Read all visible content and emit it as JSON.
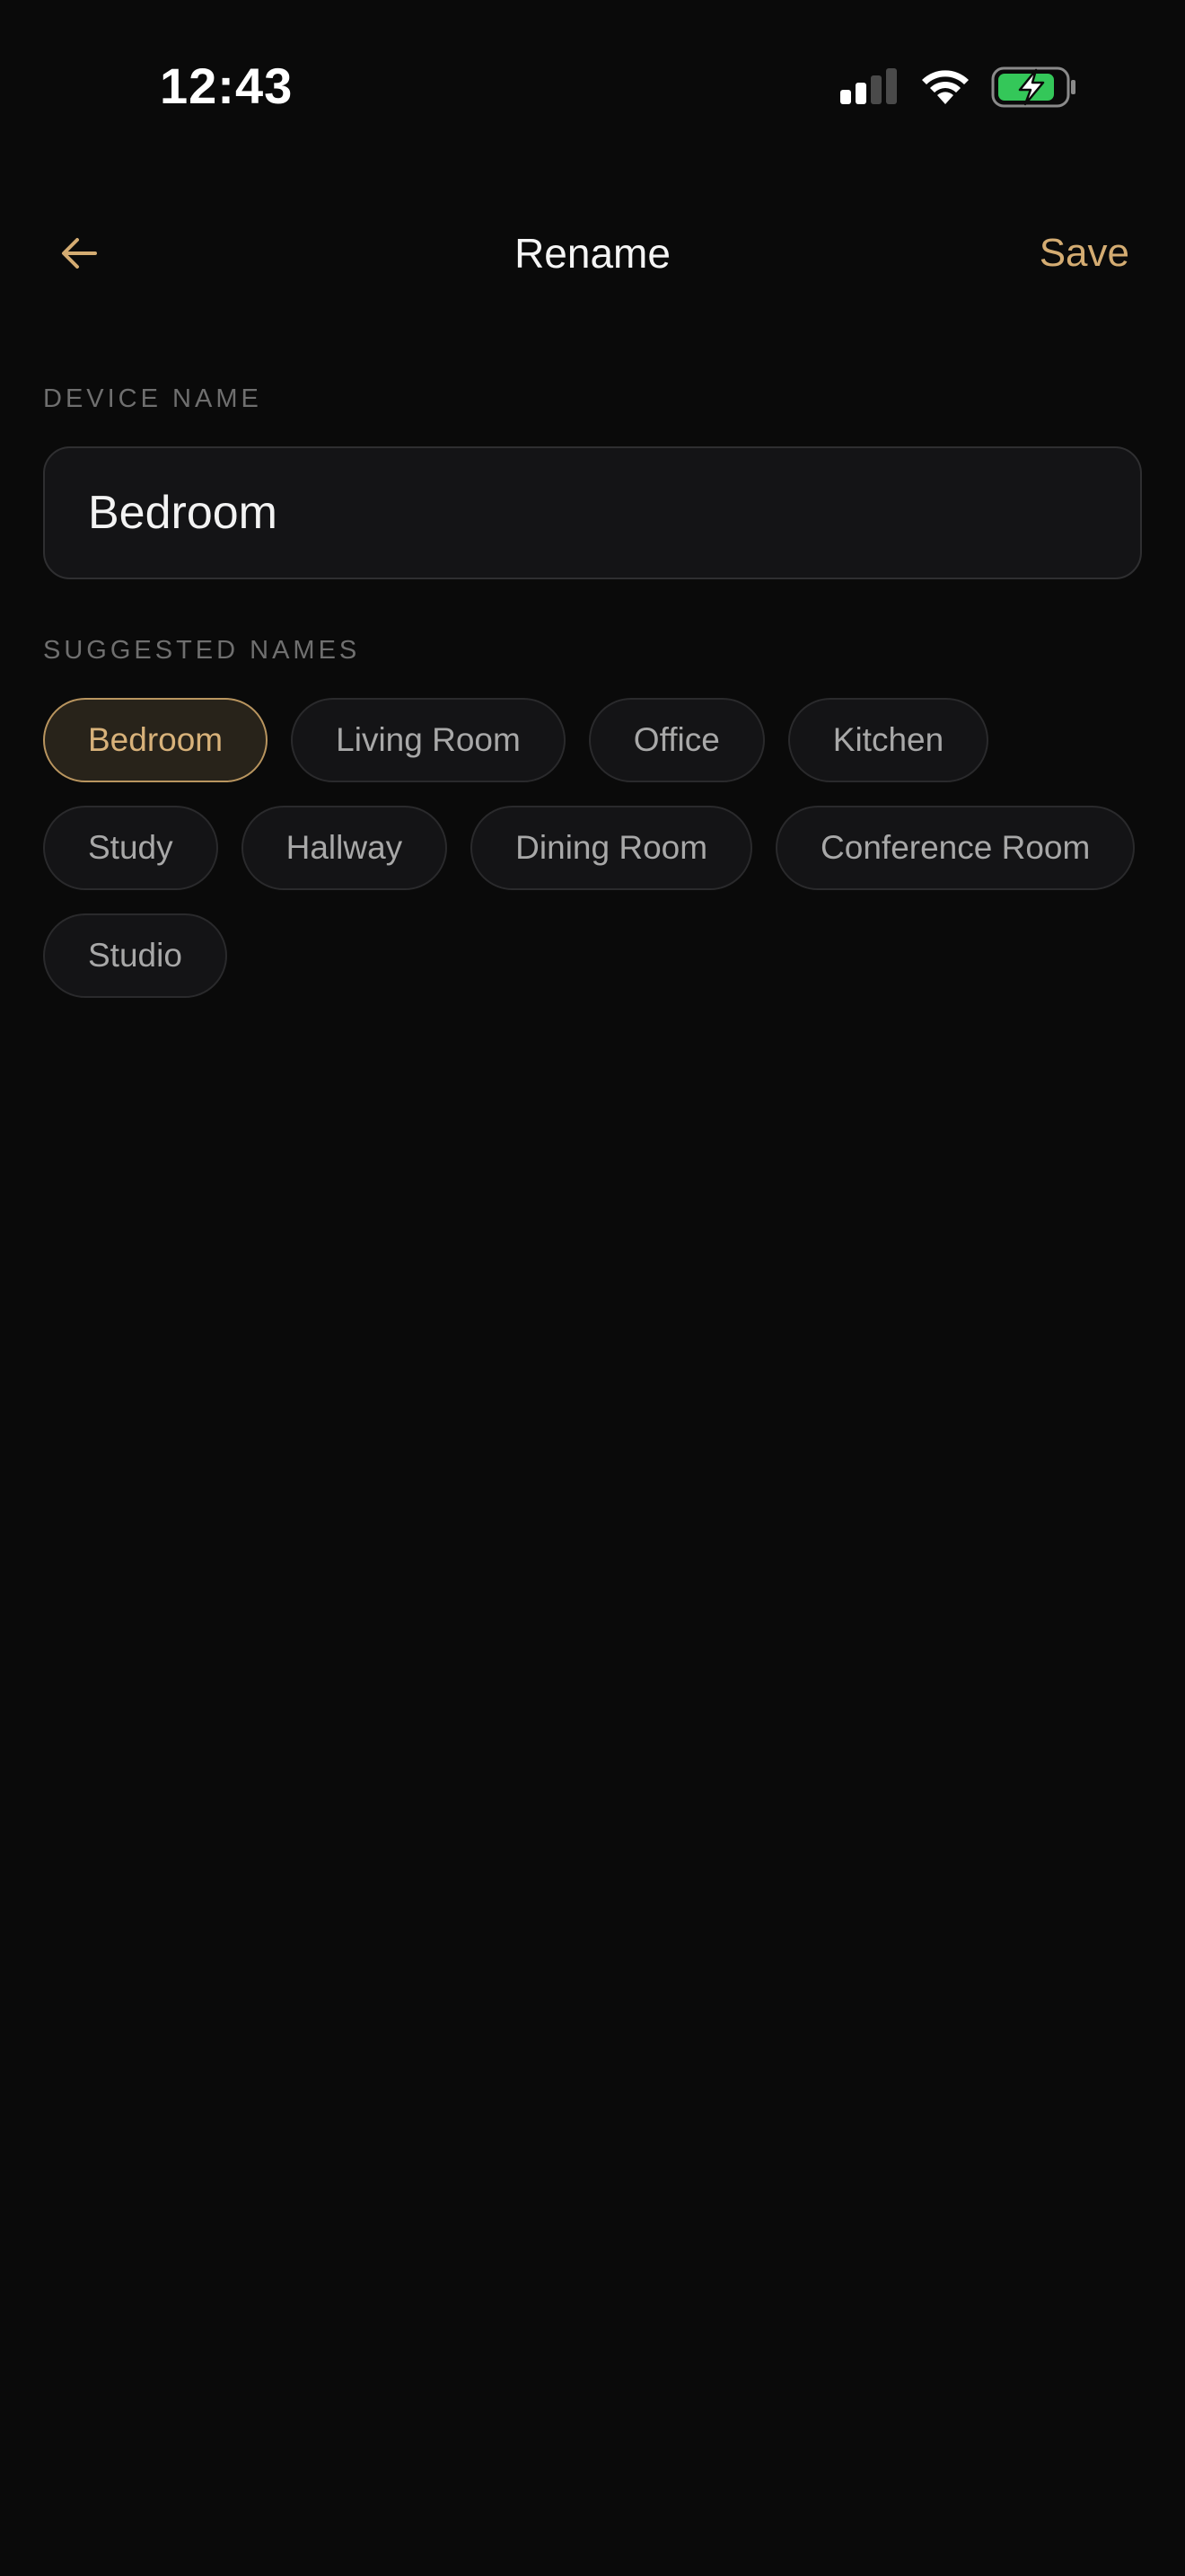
{
  "status_bar": {
    "time": "12:43",
    "signal_icon": "cellular-signal-icon",
    "wifi_icon": "wifi-icon",
    "battery_icon": "battery-charging-icon",
    "battery_color": "#34c759"
  },
  "nav": {
    "back_icon": "arrow-left-icon",
    "title": "Rename",
    "save_label": "Save",
    "accent_color": "#d4ac72"
  },
  "device_name": {
    "label": "DEVICE NAME",
    "value": "Bedroom"
  },
  "suggested": {
    "label": "SUGGESTED NAMES",
    "selected": "Bedroom",
    "chips": [
      {
        "label": "Bedroom"
      },
      {
        "label": "Living Room"
      },
      {
        "label": "Office"
      },
      {
        "label": "Kitchen"
      },
      {
        "label": "Study"
      },
      {
        "label": "Hallway"
      },
      {
        "label": "Dining Room"
      },
      {
        "label": "Conference Room"
      },
      {
        "label": "Studio"
      }
    ]
  }
}
